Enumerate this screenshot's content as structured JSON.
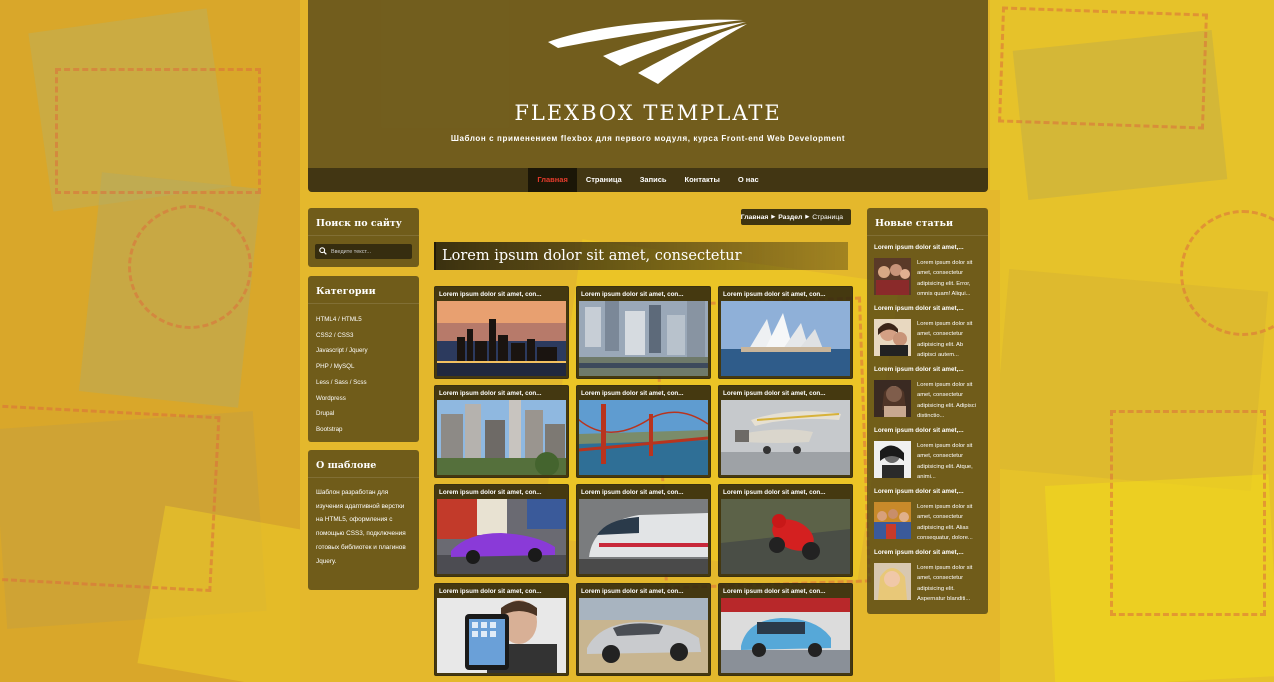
{
  "site": {
    "title": "FLEXBOX TEMPLATE",
    "subtitle": "Шаблон с применением flexbox для первого модуля, курса Front-end Web Development"
  },
  "nav": [
    {
      "label": "Главная",
      "active": true
    },
    {
      "label": "Страница",
      "active": false
    },
    {
      "label": "Запись",
      "active": false
    },
    {
      "label": "Контакты",
      "active": false
    },
    {
      "label": "О нас",
      "active": false
    }
  ],
  "search": {
    "title": "Поиск по сайту",
    "placeholder": "Введите текст...",
    "icon": "search-icon"
  },
  "categories": {
    "title": "Категории",
    "items": [
      "HTML4 / HTML5",
      "CSS2 / CSS3",
      "Javascript / Jquery",
      "PHP / MySQL",
      "Less / Sass / Scss",
      "Wordpress",
      "Drupal",
      "Bootstrap"
    ]
  },
  "about": {
    "title": "О шаблоне",
    "text": "Шаблон разработан для изучения адаптивной верстки на HTML5, оформления с помощью CSS3, подключения готовых библиотек и плагинов Jquery."
  },
  "breadcrumb": {
    "home": "Главная",
    "section": "Раздел",
    "current": "Страница"
  },
  "article": {
    "title": "Lorem ipsum dolor sit amet, consectetur"
  },
  "gallery": [
    {
      "caption": "Lorem ipsum dolor sit amet, con...",
      "image": "city-night-skyline"
    },
    {
      "caption": "Lorem ipsum dolor sit amet, con...",
      "image": "aerial-city"
    },
    {
      "caption": "Lorem ipsum dolor sit amet, con...",
      "image": "sydney-opera-house"
    },
    {
      "caption": "Lorem ipsum dolor sit amet, con...",
      "image": "city-buildings"
    },
    {
      "caption": "Lorem ipsum dolor sit amet, con...",
      "image": "golden-gate-bridge"
    },
    {
      "caption": "Lorem ipsum dolor sit amet, con...",
      "image": "airplane-hangar"
    },
    {
      "caption": "Lorem ipsum dolor sit amet, con...",
      "image": "purple-sports-car"
    },
    {
      "caption": "Lorem ipsum dolor sit amet, con...",
      "image": "high-speed-train"
    },
    {
      "caption": "Lorem ipsum dolor sit amet, con...",
      "image": "motorcycle-racer"
    },
    {
      "caption": "Lorem ipsum dolor sit amet, con...",
      "image": "man-with-tablet"
    },
    {
      "caption": "Lorem ipsum dolor sit amet, con...",
      "image": "silver-car"
    },
    {
      "caption": "Lorem ipsum dolor sit amet, con...",
      "image": "blue-mini"
    }
  ],
  "news": {
    "title": "Новые статьи",
    "items": [
      {
        "title": "Lorem ipsum dolor sit amet,...",
        "text": "Lorem ipsum dolor sit amet, consectetur adipisicing elit. Error, omnis quam! Aliqui...",
        "image": "group-photo"
      },
      {
        "title": "Lorem ipsum dolor sit amet,...",
        "text": "Lorem ipsum dolor sit amet, consectetur adipisicing elit. Ab adipisci autem...",
        "image": "couple-photo"
      },
      {
        "title": "Lorem ipsum dolor sit amet,...",
        "text": "Lorem ipsum dolor sit amet, consectetur adipisicing elit. Adipisci distinctio...",
        "image": "woman-portrait"
      },
      {
        "title": "Lorem ipsum dolor sit amet,...",
        "text": "Lorem ipsum dolor sit amet, consectetur adipisicing elit. Atque, animi...",
        "image": "bw-portrait"
      },
      {
        "title": "Lorem ipsum dolor sit amet,...",
        "text": "Lorem ipsum dolor sit amet, consectetur adipisicing elit. Alias consequatur, dolore...",
        "image": "crowd-photo"
      },
      {
        "title": "Lorem ipsum dolor sit amet,...",
        "text": "Lorem ipsum dolor sit amet, consectetur adipisicing elit. Aspernatur blanditi...",
        "image": "blonde-girl"
      }
    ]
  },
  "colors": {
    "background": "#e3b52a",
    "panel": "#50421a",
    "active_nav": "#e53b2c",
    "text": "#ffffff"
  }
}
